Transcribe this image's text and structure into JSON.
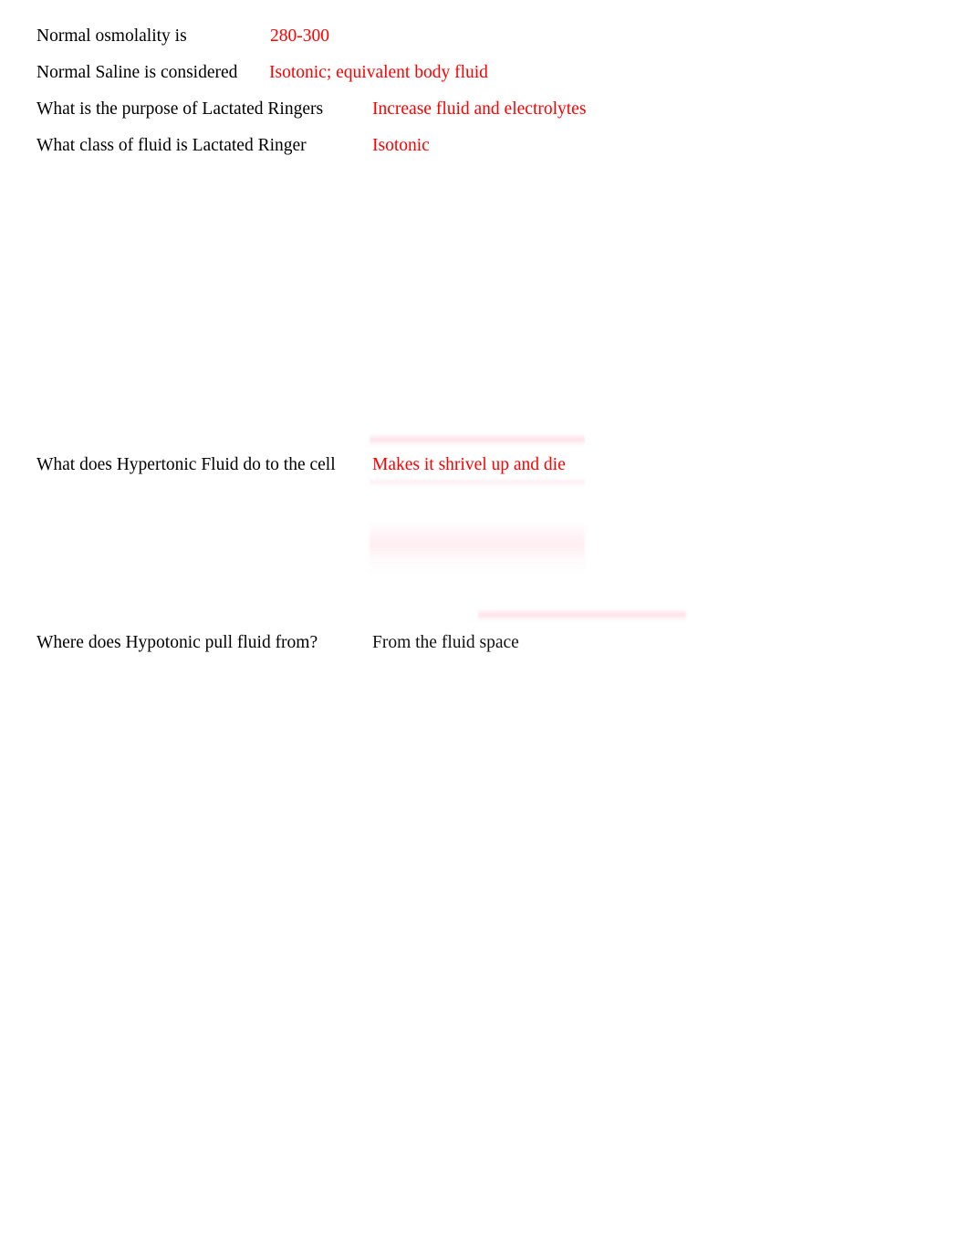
{
  "document": {
    "background_color": "#ffffff",
    "question_color": "#000000",
    "answer_color_red": "#ff0000",
    "answer_color_black": "#111111"
  },
  "rows": [
    {
      "question": "Normal osmolality is",
      "answer": "280-300",
      "answer_color": "red"
    },
    {
      "question": "Normal Saline is considered",
      "answer": "Isotonic; equivalent body fluid",
      "answer_color": "red"
    },
    {
      "question": "What is the purpose of Lactated Ringers",
      "answer": "Increase fluid and electrolytes",
      "answer_color": "red"
    },
    {
      "question": "What class of fluid is Lactated Ringer",
      "answer": "Isotonic",
      "answer_color": "red"
    },
    {
      "question": "What does Hypertonic Fluid do to the cell",
      "answer": "Makes it shrivel up and die",
      "answer_color": "red"
    },
    {
      "question": "Where does Hypotonic pull fluid from?",
      "answer": "From the fluid space",
      "answer_color": "black"
    }
  ]
}
